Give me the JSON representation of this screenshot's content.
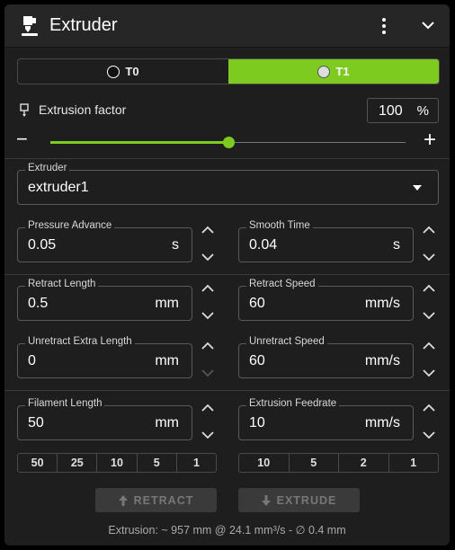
{
  "header": {
    "title": "Extruder"
  },
  "tools": [
    {
      "label": "T0",
      "active": false
    },
    {
      "label": "T1",
      "active": true
    }
  ],
  "extrusion_factor": {
    "label": "Extrusion factor",
    "value": "100",
    "unit": "%",
    "level_percent": 100,
    "minus": "−",
    "plus": "+"
  },
  "extruder_select": {
    "label": "Extruder",
    "value": "extruder1"
  },
  "pressure_advance": {
    "label": "Pressure Advance",
    "value": "0.05",
    "unit": "s"
  },
  "smooth_time": {
    "label": "Smooth Time",
    "value": "0.04",
    "unit": "s"
  },
  "retract_length": {
    "label": "Retract Length",
    "value": "0.5",
    "unit": "mm"
  },
  "retract_speed": {
    "label": "Retract Speed",
    "value": "60",
    "unit": "mm/s"
  },
  "unretract_extra_length": {
    "label": "Unretract Extra Length",
    "value": "0",
    "unit": "mm"
  },
  "unretract_speed": {
    "label": "Unretract Speed",
    "value": "60",
    "unit": "mm/s"
  },
  "filament_length": {
    "label": "Filament Length",
    "value": "50",
    "unit": "mm",
    "presets": [
      "50",
      "25",
      "10",
      "5",
      "1"
    ]
  },
  "extrusion_feedrate": {
    "label": "Extrusion Feedrate",
    "value": "10",
    "unit": "mm/s",
    "presets": [
      "10",
      "5",
      "2",
      "1"
    ]
  },
  "actions": {
    "retract": "RETRACT",
    "extrude": "EXTRUDE"
  },
  "footer": "Extrusion: ~ 957 mm @ 24.1 mm³/s - ∅ 0.4 mm",
  "colors": {
    "accent": "#7ecb20",
    "panel": "#1e1e1e",
    "header": "#262626"
  }
}
